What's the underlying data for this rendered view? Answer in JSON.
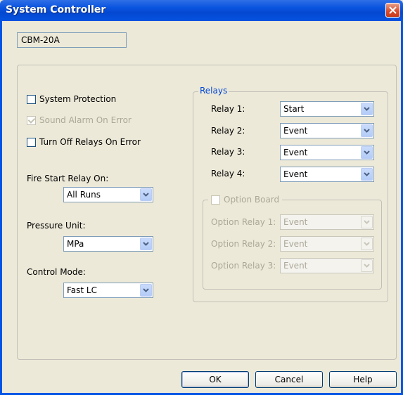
{
  "window": {
    "title": "System Controller"
  },
  "device": {
    "name": "CBM-20A"
  },
  "options": {
    "system_protection": "System Protection",
    "sound_alarm": "Sound Alarm On Error",
    "turn_off_relays": "Turn Off Relays On Error"
  },
  "fire_start": {
    "label": "Fire Start Relay On:",
    "value": "All Runs"
  },
  "pressure_unit": {
    "label": "Pressure Unit:",
    "value": "MPa"
  },
  "control_mode": {
    "label": "Control Mode:",
    "value": "Fast LC"
  },
  "relays": {
    "title": "Relays",
    "items": [
      {
        "label": "Relay 1:",
        "value": "Start"
      },
      {
        "label": "Relay 2:",
        "value": "Event"
      },
      {
        "label": "Relay 3:",
        "value": "Event"
      },
      {
        "label": "Relay 4:",
        "value": "Event"
      }
    ]
  },
  "option_board": {
    "title": "Option Board",
    "items": [
      {
        "label": "Option Relay 1:",
        "value": "Event"
      },
      {
        "label": "Option Relay 2:",
        "value": "Event"
      },
      {
        "label": "Option Relay 3:",
        "value": "Event"
      }
    ]
  },
  "buttons": {
    "ok": "OK",
    "cancel": "Cancel",
    "help": "Help"
  },
  "colors": {
    "title_bar": "#0a55e0",
    "group_title": "#0046d5",
    "disabled_text": "#aca899"
  },
  "icons": {
    "close": "close-icon",
    "dropdown": "chevron-down-icon"
  }
}
